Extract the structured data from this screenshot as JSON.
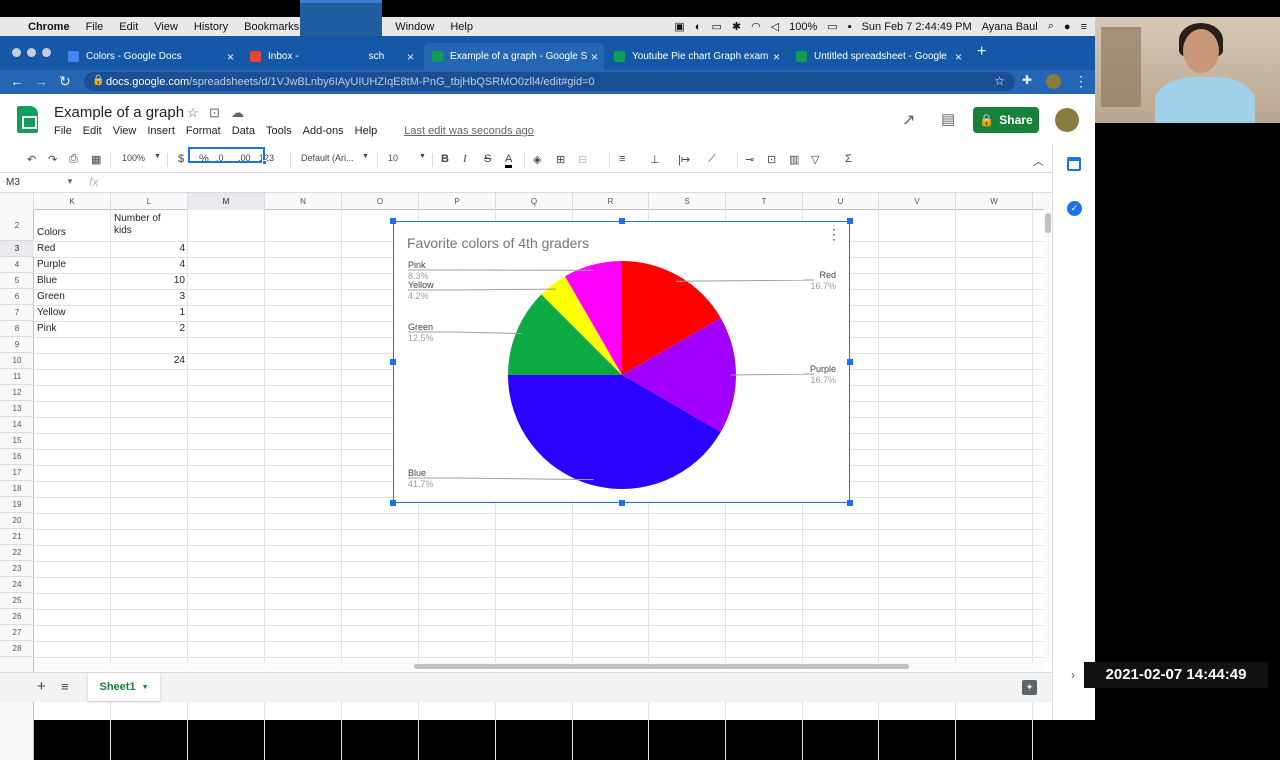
{
  "menubar": {
    "app": "Chrome",
    "items": [
      "File",
      "Edit",
      "View",
      "History",
      "Bookmarks",
      "Window",
      "Help"
    ],
    "battery": "100%",
    "clock": "Sun Feb 7  2:44:49 PM",
    "user": "Ayana Baul"
  },
  "tabs": [
    {
      "title": "Colors - Google Docs",
      "color": "#4285f4"
    },
    {
      "title": "Inbox - ",
      "color": "#ea4335"
    },
    {
      "title": "Example of a graph - Google S",
      "color": "#0f9d58"
    },
    {
      "title": "Youtube Pie chart Graph exam",
      "color": "#0f9d58"
    },
    {
      "title": "Untitled spreadsheet - Google",
      "color": "#0f9d58"
    }
  ],
  "tab_partial": "sch",
  "address": {
    "host": "docs.google.com",
    "path": "/spreadsheets/d/1VJwBLnby6IAyUIUHZIqE8tM-PnG_tbjHbQSRMO0zll4/edit#gid=0"
  },
  "doc": {
    "title": "Example of a graph",
    "menus": [
      "File",
      "Edit",
      "View",
      "Insert",
      "Format",
      "Data",
      "Tools",
      "Add-ons",
      "Help"
    ],
    "last_edit": "Last edit was seconds ago",
    "share": "Share"
  },
  "toolbar": {
    "zoom": "100%",
    "currency": "$",
    "percent": "%",
    "dec_less": ".0",
    "dec_more": ".00",
    "format": "123",
    "font": "Default (Ari...",
    "size": "10",
    "bold": "B",
    "italic": "I",
    "strike": "S",
    "color": "A"
  },
  "namebox": "M3",
  "fx": "fx",
  "columns": [
    "K",
    "L",
    "M",
    "N",
    "O",
    "P",
    "Q",
    "R",
    "S",
    "T",
    "U",
    "V",
    "W"
  ],
  "rows": [
    "2",
    "3",
    "4",
    "5",
    "6",
    "7",
    "8",
    "9",
    "10",
    "11",
    "12",
    "13",
    "14",
    "15",
    "16",
    "17",
    "18",
    "19",
    "20",
    "21",
    "22",
    "23",
    "24",
    "25",
    "26",
    "27",
    "28"
  ],
  "table": {
    "header_colors": "Colors",
    "header_count": "Number of kids",
    "rows": [
      {
        "color": "Red",
        "kids": "4"
      },
      {
        "color": "Purple",
        "kids": "4"
      },
      {
        "color": "Blue",
        "kids": "10"
      },
      {
        "color": "Green",
        "kids": "3"
      },
      {
        "color": "Yellow",
        "kids": "1"
      },
      {
        "color": "Pink",
        "kids": "2"
      }
    ],
    "total": "24"
  },
  "chart_data": {
    "type": "pie",
    "title": "Favorite colors of 4th graders",
    "categories": [
      "Red",
      "Purple",
      "Blue",
      "Green",
      "Yellow",
      "Pink"
    ],
    "values": [
      4,
      4,
      10,
      3,
      1,
      2
    ],
    "labels": [
      "16.7%",
      "16.7%",
      "41.7%",
      "12.5%",
      "4.2%",
      "8.3%"
    ],
    "colors": [
      "#ff0000",
      "#a100ff",
      "#2a00ff",
      "#0ea844",
      "#ffff00",
      "#ff00ff"
    ],
    "start_angle_deg": 0,
    "direction": "clockwise",
    "legend": "labeled"
  },
  "sheet_tab": "Sheet1",
  "timestamp": "2021-02-07  14:44:49"
}
